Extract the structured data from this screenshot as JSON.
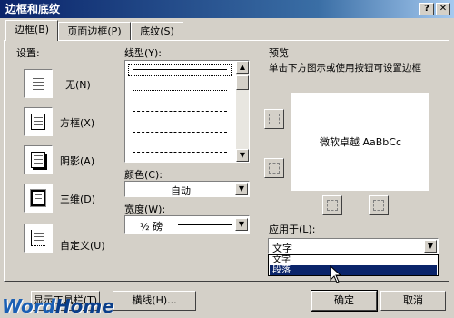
{
  "window": {
    "title": "边框和底纹"
  },
  "tabs": [
    {
      "label": "边框(B)",
      "active": true
    },
    {
      "label": "页面边框(P)",
      "active": false
    },
    {
      "label": "底纹(S)",
      "active": false
    }
  ],
  "settings": {
    "heading": "设置:",
    "items": [
      {
        "label": "无(N)",
        "icon": "border-none-icon"
      },
      {
        "label": "方框(X)",
        "icon": "border-box-icon"
      },
      {
        "label": "阴影(A)",
        "icon": "border-shadow-icon"
      },
      {
        "label": "三维(D)",
        "icon": "border-3d-icon"
      },
      {
        "label": "自定义(U)",
        "icon": "border-custom-icon"
      }
    ]
  },
  "style": {
    "label": "线型(Y):"
  },
  "color": {
    "label": "颜色(C):",
    "value": "自动"
  },
  "width": {
    "label": "宽度(W):",
    "value": "½ 磅"
  },
  "preview": {
    "label": "预览",
    "hint": "单击下方图示或使用按钮可设置边框",
    "sample": "微软卓越 AaBbCc"
  },
  "apply_to": {
    "label": "应用于(L):",
    "value": "文字",
    "options": [
      "文字",
      "段落"
    ],
    "highlighted": "段落"
  },
  "buttons": {
    "toolbar": "显示工具栏(T)",
    "hline": "横线(H)...",
    "ok": "确定",
    "cancel": "取消"
  },
  "watermark": {
    "left": "Word",
    "right": "Home"
  },
  "colors": {
    "title_start": "#0a246a",
    "title_end": "#a6caf0",
    "highlight": "#0a246a",
    "face": "#d4d0c8"
  }
}
